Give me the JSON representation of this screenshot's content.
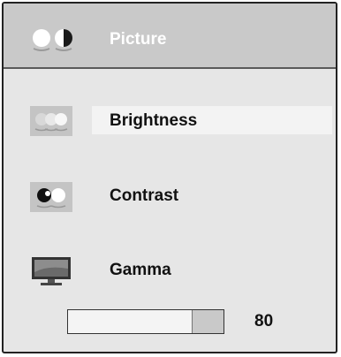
{
  "menu": {
    "title": "Picture",
    "header_icon": "picture-icon",
    "items": [
      {
        "label": "Brightness",
        "icon": "brightness-icon",
        "selected": true
      },
      {
        "label": "Contrast",
        "icon": "contrast-icon",
        "selected": false
      },
      {
        "label": "Gamma",
        "icon": "gamma-icon",
        "selected": false
      }
    ]
  },
  "slider": {
    "value": "80",
    "fill_fraction": 0.8
  },
  "colors": {
    "header_background": "#c9c9c9",
    "panel_background": "#e6e6e6",
    "highlight": "#f3f3f3"
  }
}
